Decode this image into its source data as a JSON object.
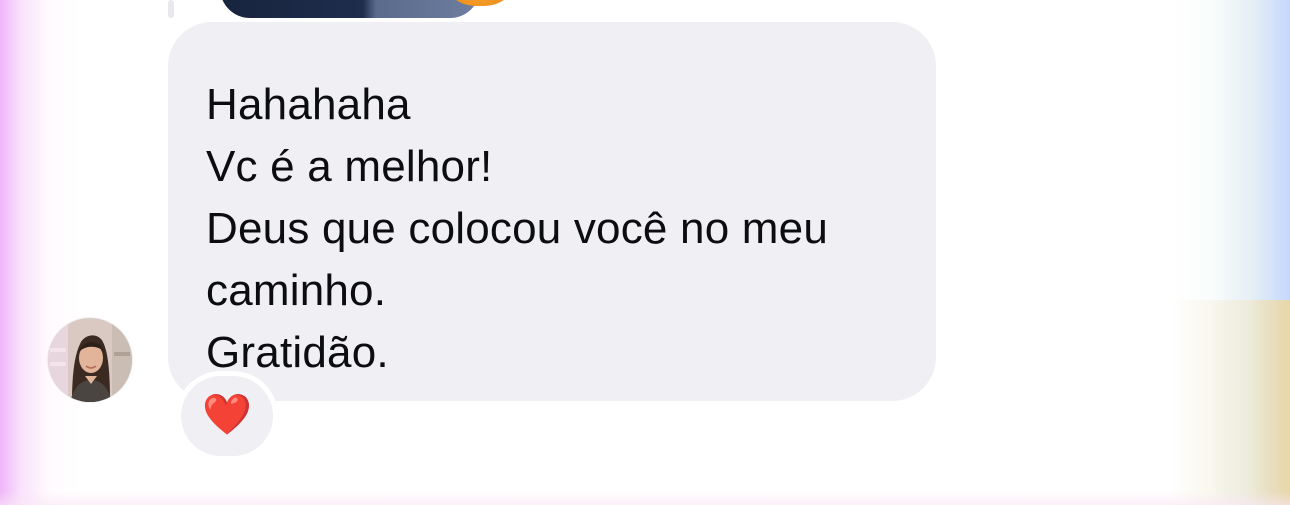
{
  "message": {
    "lines": [
      "Hahahaha",
      "Vc é a melhor!",
      "Deus que colocou você no meu caminho.",
      "Gratidão."
    ],
    "bubble_color": "#efeff4",
    "text_color": "#0c0d10"
  },
  "reaction": {
    "emoji": "❤️",
    "icon": "red-heart-icon"
  },
  "avatar": {
    "icon": "contact-avatar"
  },
  "theme": {
    "background": "#ffffff",
    "edge_glow_left": "#eca8f8",
    "edge_glow_right": "#bed2ff"
  }
}
